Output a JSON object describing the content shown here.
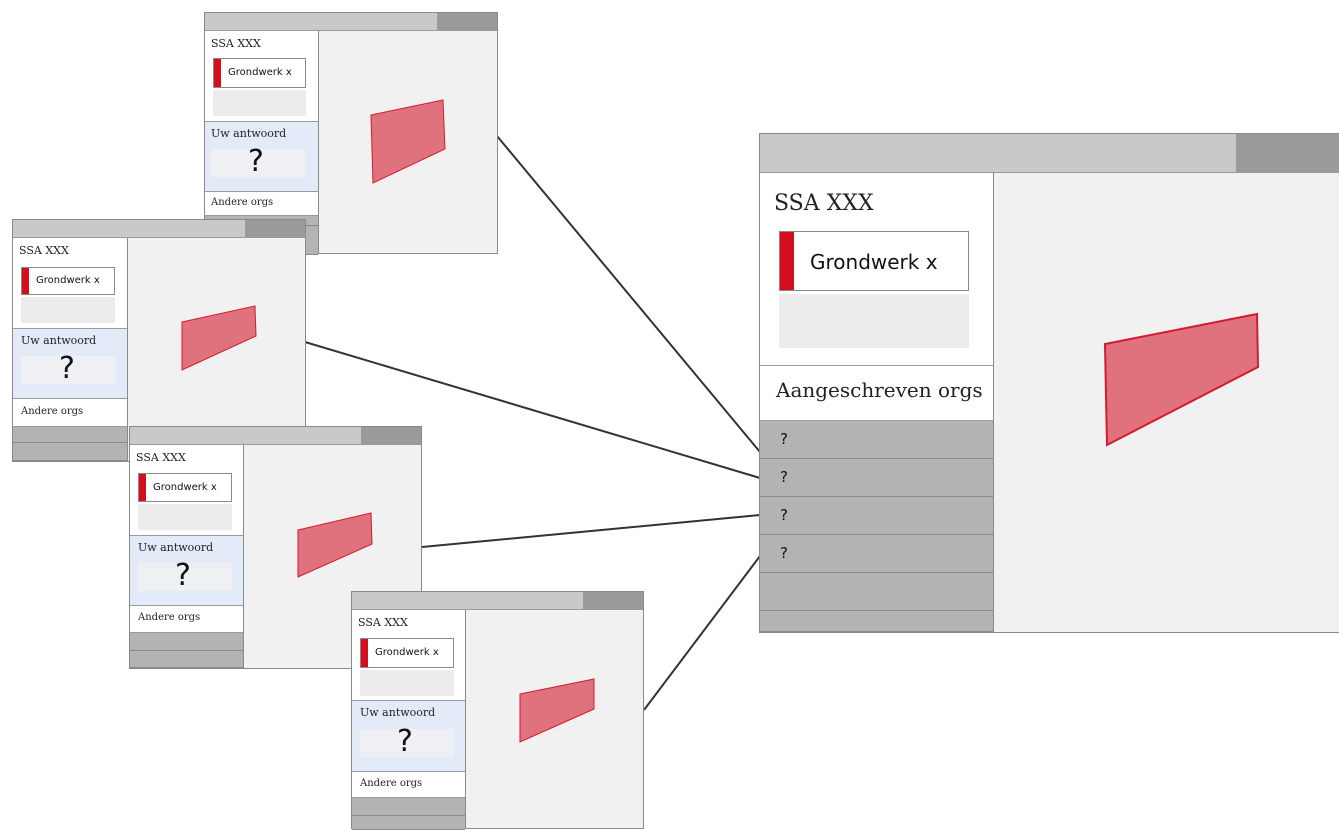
{
  "windows": [
    {
      "title": "SSA XXX",
      "card_label": "Grondwerk x",
      "answer_label": "Uw antwoord",
      "answer_value": "?",
      "others_label": "Andere orgs"
    },
    {
      "title": "SSA XXX",
      "card_label": "Grondwerk x",
      "answer_label": "Uw antwoord",
      "answer_value": "?",
      "others_label": "Andere orgs"
    },
    {
      "title": "SSA XXX",
      "card_label": "Grondwerk x",
      "answer_label": "Uw antwoord",
      "answer_value": "?",
      "others_label": "Andere orgs"
    },
    {
      "title": "SSA XXX",
      "card_label": "Grondwerk x",
      "answer_label": "Uw antwoord",
      "answer_value": "?",
      "others_label": "Andere orgs"
    }
  ],
  "main_window": {
    "title": "SSA XXX",
    "card_label": "Grondwerk x",
    "section_label": "Aangeschreven orgs",
    "responses": [
      "?",
      "?",
      "?",
      "?"
    ]
  },
  "colors": {
    "accent_red": "#d30f1e",
    "shape_fill": "#e0727d",
    "shape_stroke": "#d31c2c",
    "answer_bg": "#e3ebf8"
  }
}
